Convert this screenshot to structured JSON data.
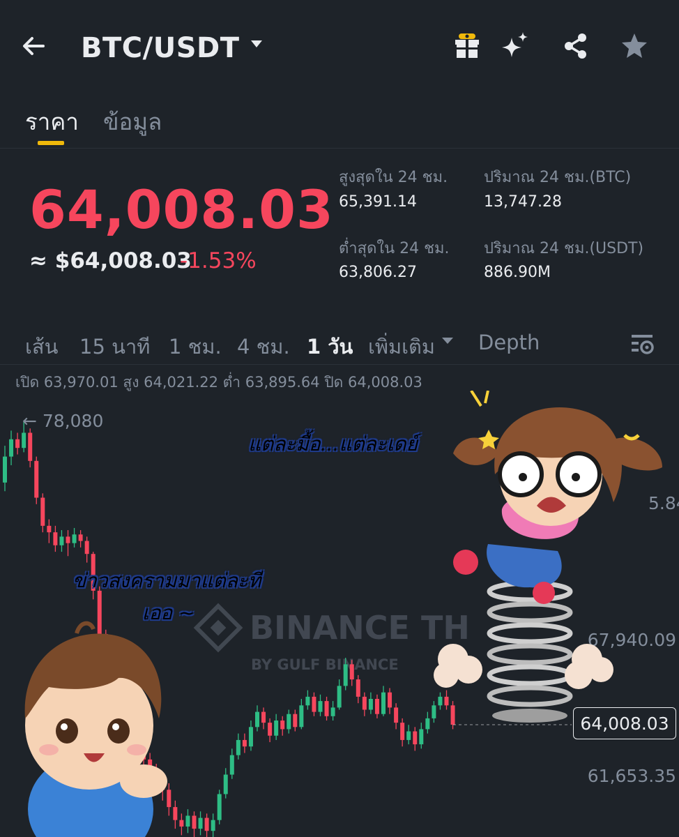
{
  "header": {
    "pair": "BTC/USDT",
    "icons": [
      "back-arrow-icon",
      "gift-icon",
      "sparkle-icon",
      "share-icon",
      "star-icon"
    ]
  },
  "tabs": {
    "price": "ราคา",
    "info": "ข้อมูล"
  },
  "ticker": {
    "last_price": "64,008.03",
    "approx": "≈ $64,008.03",
    "change": "-1.53%",
    "high_label": "สูงสุดใน 24 ชม.",
    "high_value": "65,391.14",
    "vol_btc_label": "ปริมาณ 24 ชม.(BTC)",
    "vol_btc_value": "13,747.28",
    "low_label": "ต่ำสุดใน 24 ชม.",
    "low_value": "63,806.27",
    "vol_usdt_label": "ปริมาณ 24 ชม.(USDT)",
    "vol_usdt_value": "886.90M"
  },
  "intervals": {
    "line": "เส้น",
    "m15": "15 นาที",
    "h1": "1 ชม.",
    "h4": "4 ชม.",
    "d1": "1 วัน",
    "more": "เพิ่มเติม",
    "depth": "Depth"
  },
  "ohlc": "เปิด 63,970.01 สูง 64,021.22 ต่ำ 63,895.64 ปิด 64,008.03",
  "chart": {
    "high_marker": "← 78,080",
    "axis_labels": [
      {
        "text": "67,940.09",
        "value": 67940.09
      },
      {
        "text": "61,653.35",
        "value": 61653.35
      }
    ],
    "partial_axis_label": "5.84",
    "current_price_tag": "64,008.03",
    "watermark_main": "BINANCE TH",
    "watermark_sub": "BY GULF BINANCE"
  },
  "captions": {
    "girl": "แต่ละมื้อ...แต่ละเดย์",
    "boy_line1": "ข่าวสงครามมาแต่ละที",
    "boy_line2": "เออ ~"
  },
  "colors": {
    "background": "#1e2329",
    "up": "#2ebd85",
    "down": "#f6465d",
    "accent": "#f0b90b",
    "muted": "#848e9c"
  },
  "chart_data": {
    "type": "candlestick",
    "y_axis_labels": [
      67940.09,
      61653.35
    ],
    "last_price": 64008.03,
    "period_high": 78080,
    "candles": [
      {
        "o": 75200,
        "c": 76400,
        "h": 76900,
        "l": 74800
      },
      {
        "o": 76400,
        "c": 77200,
        "h": 77600,
        "l": 76000
      },
      {
        "o": 77200,
        "c": 76800,
        "h": 77500,
        "l": 76500
      },
      {
        "o": 76800,
        "c": 77500,
        "h": 78080,
        "l": 76600
      },
      {
        "o": 77500,
        "c": 76200,
        "h": 77700,
        "l": 75900
      },
      {
        "o": 76200,
        "c": 74500,
        "h": 76400,
        "l": 74200
      },
      {
        "o": 74500,
        "c": 73200,
        "h": 74700,
        "l": 72900
      },
      {
        "o": 73200,
        "c": 72900,
        "h": 73500,
        "l": 72400
      },
      {
        "o": 72900,
        "c": 72300,
        "h": 73200,
        "l": 72000
      },
      {
        "o": 72300,
        "c": 72700,
        "h": 73000,
        "l": 72000
      },
      {
        "o": 72700,
        "c": 72400,
        "h": 73000,
        "l": 71800
      },
      {
        "o": 72400,
        "c": 72800,
        "h": 73100,
        "l": 72200
      },
      {
        "o": 72800,
        "c": 72500,
        "h": 73000,
        "l": 72200
      },
      {
        "o": 72500,
        "c": 71900,
        "h": 72700,
        "l": 71500
      },
      {
        "o": 71900,
        "c": 70200,
        "h": 72000,
        "l": 69800
      },
      {
        "o": 70200,
        "c": 68200,
        "h": 70400,
        "l": 67800
      },
      {
        "o": 68200,
        "c": 66500,
        "h": 68400,
        "l": 66000
      },
      {
        "o": 66500,
        "c": 65200,
        "h": 66800,
        "l": 64800
      },
      {
        "o": 65200,
        "c": 64200,
        "h": 65500,
        "l": 63800
      },
      {
        "o": 64200,
        "c": 63500,
        "h": 64500,
        "l": 63000
      },
      {
        "o": 63500,
        "c": 63100,
        "h": 63900,
        "l": 62800
      },
      {
        "o": 63100,
        "c": 62800,
        "h": 63400,
        "l": 62400
      },
      {
        "o": 62800,
        "c": 62400,
        "h": 63100,
        "l": 62000
      },
      {
        "o": 62400,
        "c": 62000,
        "h": 62700,
        "l": 61500
      },
      {
        "o": 62000,
        "c": 61500,
        "h": 62200,
        "l": 61000
      },
      {
        "o": 61500,
        "c": 61000,
        "h": 61800,
        "l": 60500
      },
      {
        "o": 61000,
        "c": 60200,
        "h": 61300,
        "l": 59800
      },
      {
        "o": 60200,
        "c": 59600,
        "h": 60500,
        "l": 59200
      },
      {
        "o": 59600,
        "c": 59300,
        "h": 59900,
        "l": 58900
      },
      {
        "o": 59300,
        "c": 59800,
        "h": 60100,
        "l": 59000
      },
      {
        "o": 59800,
        "c": 59200,
        "h": 60000,
        "l": 58800
      },
      {
        "o": 59200,
        "c": 59700,
        "h": 60000,
        "l": 58900
      },
      {
        "o": 59700,
        "c": 59100,
        "h": 59900,
        "l": 58700
      },
      {
        "o": 59100,
        "c": 59600,
        "h": 59900,
        "l": 58800
      },
      {
        "o": 59600,
        "c": 60800,
        "h": 61000,
        "l": 59400
      },
      {
        "o": 60800,
        "c": 61700,
        "h": 62000,
        "l": 60600
      },
      {
        "o": 61700,
        "c": 62600,
        "h": 62900,
        "l": 61500
      },
      {
        "o": 62600,
        "c": 63300,
        "h": 63600,
        "l": 62400
      },
      {
        "o": 63300,
        "c": 63000,
        "h": 63600,
        "l": 62700
      },
      {
        "o": 63000,
        "c": 63900,
        "h": 64200,
        "l": 62800
      },
      {
        "o": 63900,
        "c": 64600,
        "h": 64900,
        "l": 63700
      },
      {
        "o": 64600,
        "c": 64100,
        "h": 64800,
        "l": 63800
      },
      {
        "o": 64100,
        "c": 63500,
        "h": 64300,
        "l": 63200
      },
      {
        "o": 63500,
        "c": 64200,
        "h": 64500,
        "l": 63300
      },
      {
        "o": 64200,
        "c": 63800,
        "h": 64400,
        "l": 63500
      },
      {
        "o": 63800,
        "c": 64500,
        "h": 64700,
        "l": 63600
      },
      {
        "o": 64500,
        "c": 63900,
        "h": 64700,
        "l": 63700
      },
      {
        "o": 63900,
        "c": 64900,
        "h": 65200,
        "l": 63800
      },
      {
        "o": 64900,
        "c": 65300,
        "h": 65600,
        "l": 64700
      },
      {
        "o": 65300,
        "c": 64600,
        "h": 65500,
        "l": 64400
      },
      {
        "o": 64600,
        "c": 65100,
        "h": 65400,
        "l": 64400
      },
      {
        "o": 65100,
        "c": 64400,
        "h": 65300,
        "l": 64200
      },
      {
        "o": 64400,
        "c": 64800,
        "h": 65100,
        "l": 64200
      },
      {
        "o": 64800,
        "c": 65800,
        "h": 66100,
        "l": 64700
      },
      {
        "o": 65800,
        "c": 66800,
        "h": 67100,
        "l": 65600
      },
      {
        "o": 66800,
        "c": 66100,
        "h": 67000,
        "l": 65800
      },
      {
        "o": 66100,
        "c": 65300,
        "h": 66300,
        "l": 65000
      },
      {
        "o": 65300,
        "c": 64700,
        "h": 65500,
        "l": 64400
      },
      {
        "o": 64700,
        "c": 65200,
        "h": 65500,
        "l": 64500
      },
      {
        "o": 65200,
        "c": 64500,
        "h": 65400,
        "l": 64300
      },
      {
        "o": 64500,
        "c": 65500,
        "h": 65800,
        "l": 64400
      },
      {
        "o": 65500,
        "c": 64800,
        "h": 65700,
        "l": 64500
      },
      {
        "o": 64800,
        "c": 64100,
        "h": 65000,
        "l": 63800
      },
      {
        "o": 64100,
        "c": 63300,
        "h": 64300,
        "l": 63000
      },
      {
        "o": 63300,
        "c": 63700,
        "h": 64000,
        "l": 63100
      },
      {
        "o": 63700,
        "c": 63100,
        "h": 63900,
        "l": 62800
      },
      {
        "o": 63100,
        "c": 63800,
        "h": 64100,
        "l": 62900
      },
      {
        "o": 63800,
        "c": 64300,
        "h": 64600,
        "l": 63600
      },
      {
        "o": 64300,
        "c": 64900,
        "h": 65100,
        "l": 64100
      },
      {
        "o": 64900,
        "c": 65300,
        "h": 65500,
        "l": 64700
      },
      {
        "o": 65300,
        "c": 64900,
        "h": 65600,
        "l": 64700
      },
      {
        "o": 64900,
        "c": 64008.03,
        "h": 65100,
        "l": 63800
      }
    ]
  }
}
